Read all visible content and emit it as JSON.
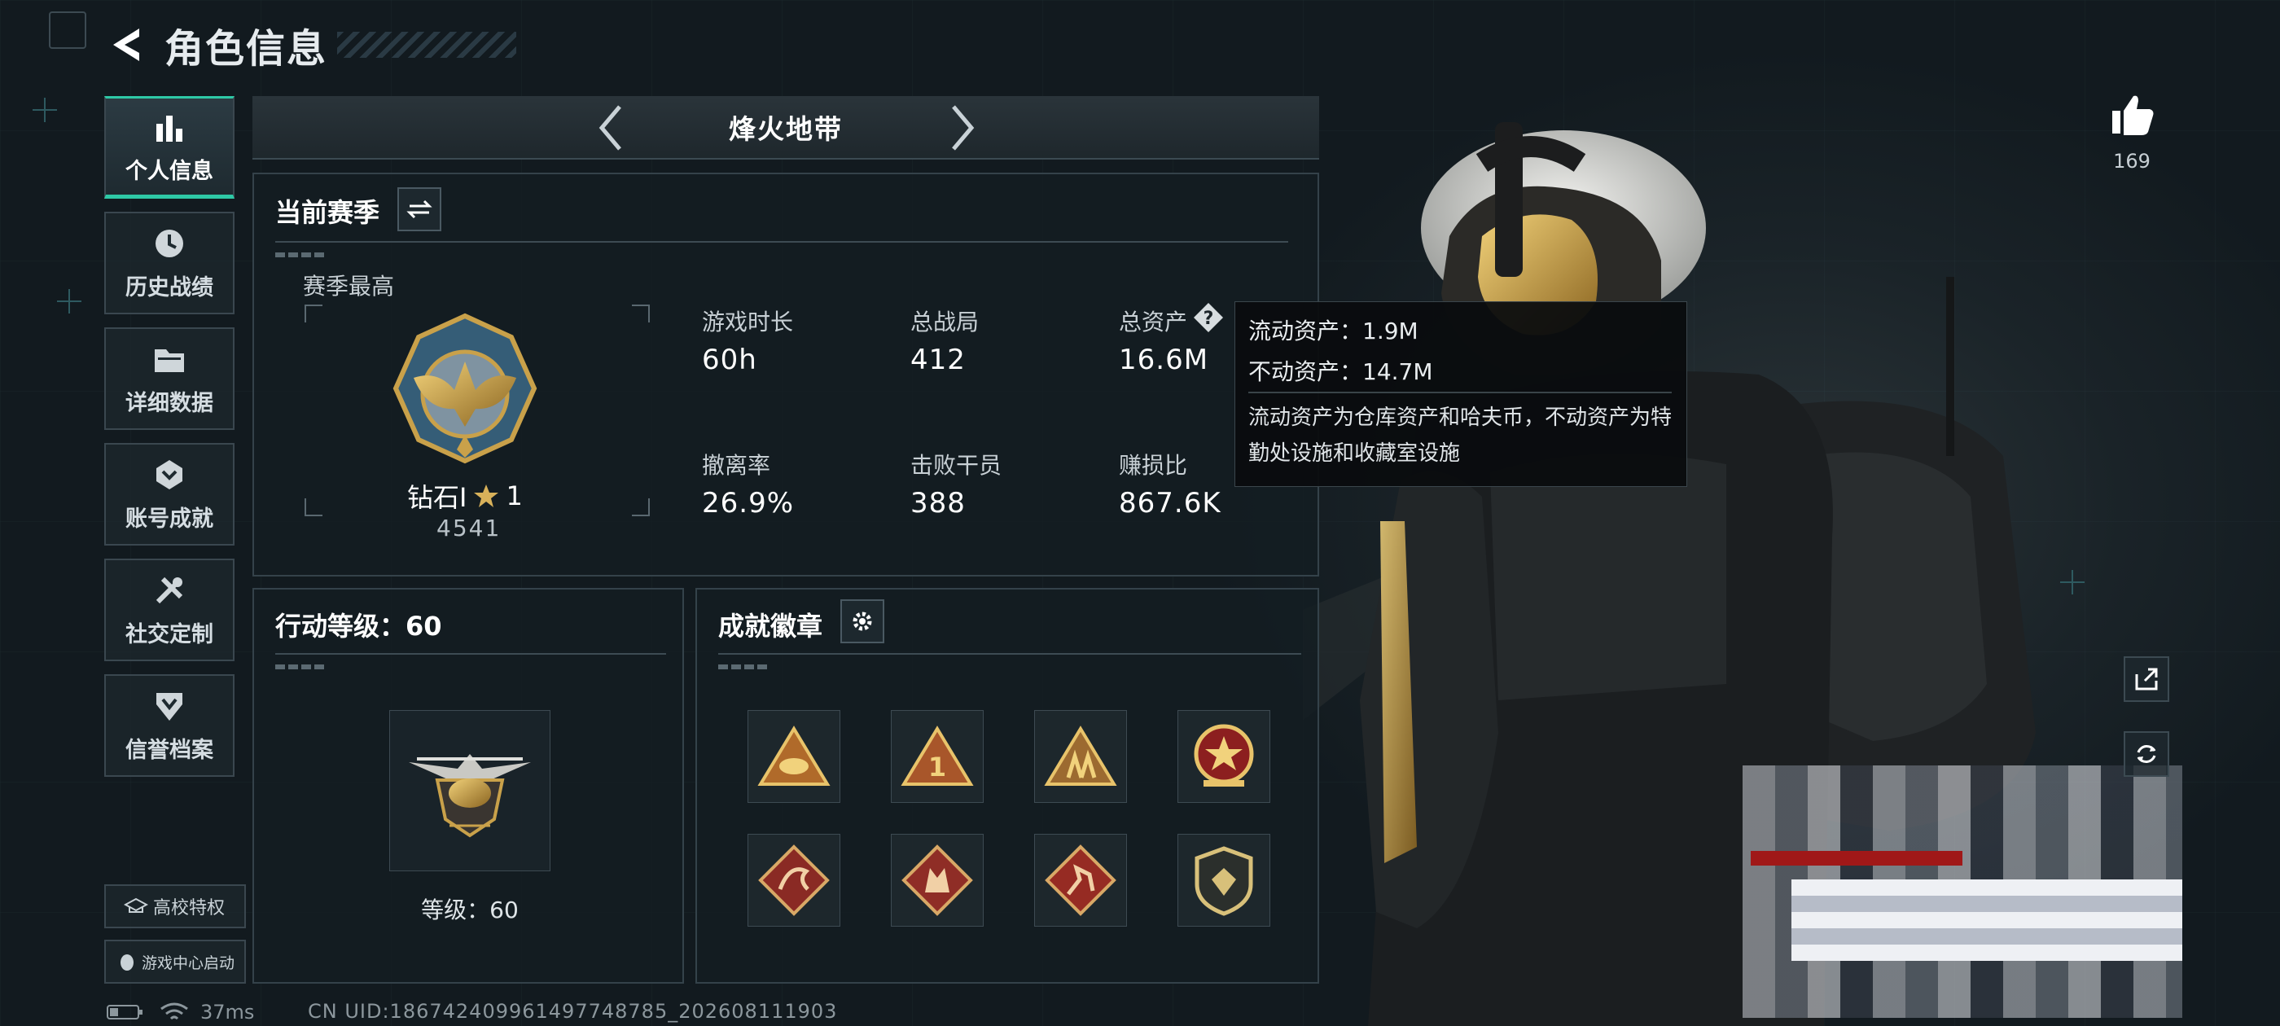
{
  "header": {
    "title": "角色信息"
  },
  "sidebar": {
    "items": [
      {
        "label": "个人信息",
        "icon": "bar-chart-icon",
        "active": true
      },
      {
        "label": "历史战绩",
        "icon": "history-clock-icon",
        "active": false
      },
      {
        "label": "详细数据",
        "icon": "folder-icon",
        "active": false
      },
      {
        "label": "账号成就",
        "icon": "achievement-icon",
        "active": false
      },
      {
        "label": "社交定制",
        "icon": "tools-icon",
        "active": false
      },
      {
        "label": "信誉档案",
        "icon": "reputation-icon",
        "active": false
      }
    ],
    "campus_button": "高校特权",
    "game_center_button": "游戏中心启动"
  },
  "mode": {
    "title": "烽火地带"
  },
  "season": {
    "title": "当前赛季",
    "best_label": "赛季最高",
    "rank_name": "钻石Ⅰ",
    "rank_stars": "1",
    "rank_score": "4541",
    "stats": [
      {
        "label": "游戏时长",
        "value": "60h"
      },
      {
        "label": "总战局",
        "value": "412"
      },
      {
        "label": "总资产",
        "value": "16.6M"
      },
      {
        "label": "撤离率",
        "value": "26.9%"
      },
      {
        "label": "击败干员",
        "value": "388"
      },
      {
        "label": "赚损比",
        "value": "867.6K"
      }
    ]
  },
  "tooltip": {
    "line1": "流动资产：1.9M",
    "line2": "不动资产：14.7M",
    "desc": "流动资产为仓库资产和哈夫币，不动资产为特勤处设施和收藏室设施"
  },
  "level": {
    "title": "行动等级：60",
    "label": "等级：60"
  },
  "badges": {
    "title": "成就徽章",
    "items": [
      "badge-1",
      "badge-2",
      "badge-3",
      "badge-4",
      "badge-5",
      "badge-6",
      "badge-7",
      "badge-8"
    ]
  },
  "right": {
    "likes": "169"
  },
  "status": {
    "ping": "37ms",
    "uid": "CN UID:1867424099614977487​85_202608111903"
  },
  "colors": {
    "accent": "#2ec9a6",
    "gold": "#c9a14a",
    "panel_border": "#34424a"
  }
}
